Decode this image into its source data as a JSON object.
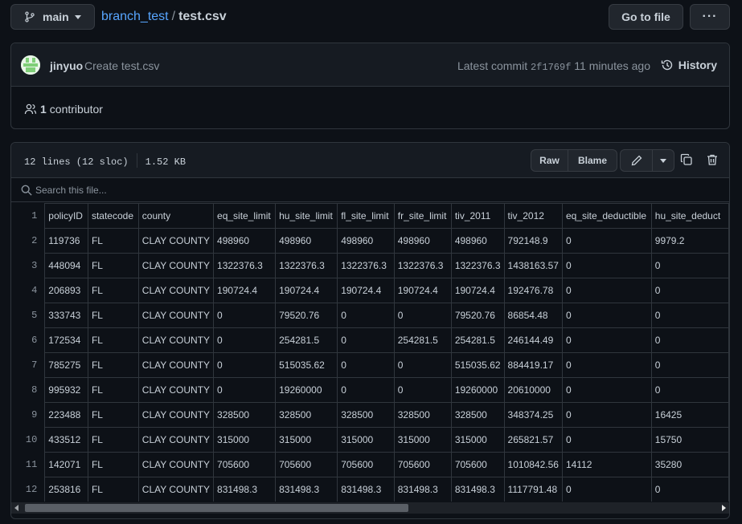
{
  "header": {
    "branch": "main",
    "repo": "branch_test",
    "separator": "/",
    "file": "test.csv",
    "goto_label": "Go to file",
    "more_label": "···"
  },
  "commit": {
    "author": "jinyuo",
    "message": "Create test.csv",
    "latest_label": "Latest commit",
    "sha": "2f1769f",
    "time": "11 minutes ago",
    "history_label": "History"
  },
  "contributors": {
    "count": "1",
    "label": "contributor"
  },
  "file": {
    "lines": "12 lines (12 sloc)",
    "size": "1.52 KB",
    "raw_label": "Raw",
    "blame_label": "Blame",
    "search_placeholder": "Search this file..."
  },
  "table": {
    "columns": [
      "policyID",
      "statecode",
      "county",
      "eq_site_limit",
      "hu_site_limit",
      "fl_site_limit",
      "fr_site_limit",
      "tiv_2011",
      "tiv_2012",
      "eq_site_deductible",
      "hu_site_deduct"
    ],
    "rows": [
      [
        "119736",
        "FL",
        "CLAY COUNTY",
        "498960",
        "498960",
        "498960",
        "498960",
        "498960",
        "792148.9",
        "0",
        "9979.2"
      ],
      [
        "448094",
        "FL",
        "CLAY COUNTY",
        "1322376.3",
        "1322376.3",
        "1322376.3",
        "1322376.3",
        "1322376.3",
        "1438163.57",
        "0",
        "0"
      ],
      [
        "206893",
        "FL",
        "CLAY COUNTY",
        "190724.4",
        "190724.4",
        "190724.4",
        "190724.4",
        "190724.4",
        "192476.78",
        "0",
        "0"
      ],
      [
        "333743",
        "FL",
        "CLAY COUNTY",
        "0",
        "79520.76",
        "0",
        "0",
        "79520.76",
        "86854.48",
        "0",
        "0"
      ],
      [
        "172534",
        "FL",
        "CLAY COUNTY",
        "0",
        "254281.5",
        "0",
        "254281.5",
        "254281.5",
        "246144.49",
        "0",
        "0"
      ],
      [
        "785275",
        "FL",
        "CLAY COUNTY",
        "0",
        "515035.62",
        "0",
        "0",
        "515035.62",
        "884419.17",
        "0",
        "0"
      ],
      [
        "995932",
        "FL",
        "CLAY COUNTY",
        "0",
        "19260000",
        "0",
        "0",
        "19260000",
        "20610000",
        "0",
        "0"
      ],
      [
        "223488",
        "FL",
        "CLAY COUNTY",
        "328500",
        "328500",
        "328500",
        "328500",
        "328500",
        "348374.25",
        "0",
        "16425"
      ],
      [
        "433512",
        "FL",
        "CLAY COUNTY",
        "315000",
        "315000",
        "315000",
        "315000",
        "315000",
        "265821.57",
        "0",
        "15750"
      ],
      [
        "142071",
        "FL",
        "CLAY COUNTY",
        "705600",
        "705600",
        "705600",
        "705600",
        "705600",
        "1010842.56",
        "14112",
        "35280"
      ],
      [
        "253816",
        "FL",
        "CLAY COUNTY",
        "831498.3",
        "831498.3",
        "831498.3",
        "831498.3",
        "831498.3",
        "1117791.48",
        "0",
        "0"
      ]
    ]
  },
  "scroll": {
    "horizontal_position": 0
  }
}
